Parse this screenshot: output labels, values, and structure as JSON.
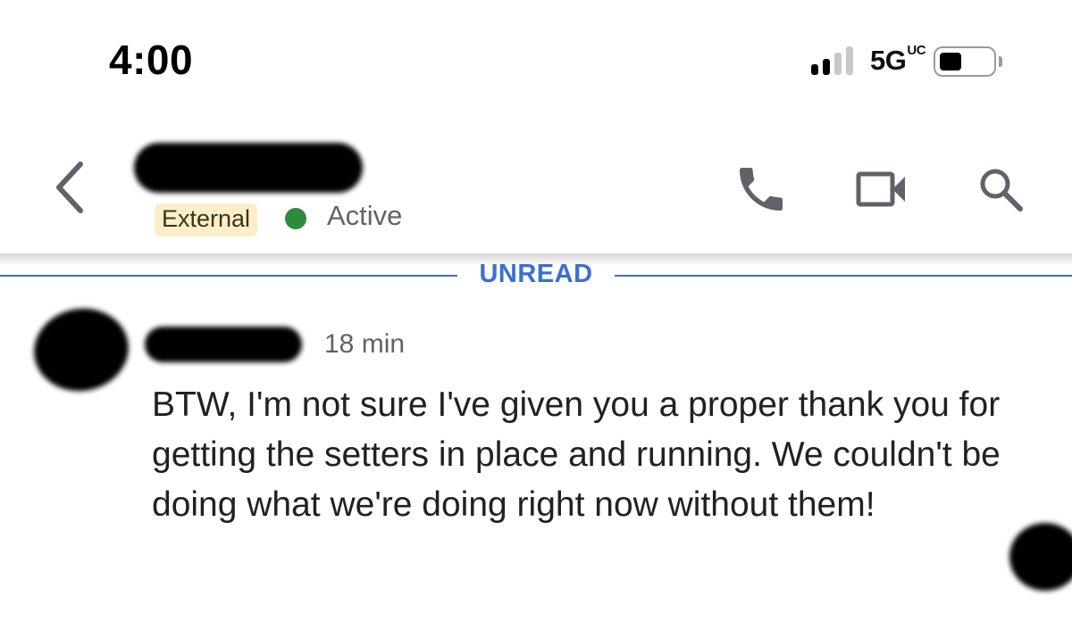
{
  "status_bar": {
    "time": "4:00",
    "network": "5G",
    "network_suffix": "UC",
    "signal_icon": "cellular-signal-icon",
    "battery_icon": "battery-icon"
  },
  "header": {
    "back_icon": "chevron-left-icon",
    "badge": "External",
    "presence": "Active",
    "presence_color": "#2e8b3a",
    "badge_color": "#fcefc7",
    "actions": {
      "call_icon": "phone-icon",
      "video_icon": "video-camera-icon",
      "search_icon": "search-icon"
    }
  },
  "divider": {
    "label": "UNREAD",
    "color": "#3b6fd1"
  },
  "message": {
    "timestamp": "18 min",
    "body": "BTW, I'm not sure I've given you a proper thank you for getting the setters in place and running. We couldn't be doing what we're doing right now without them!"
  }
}
